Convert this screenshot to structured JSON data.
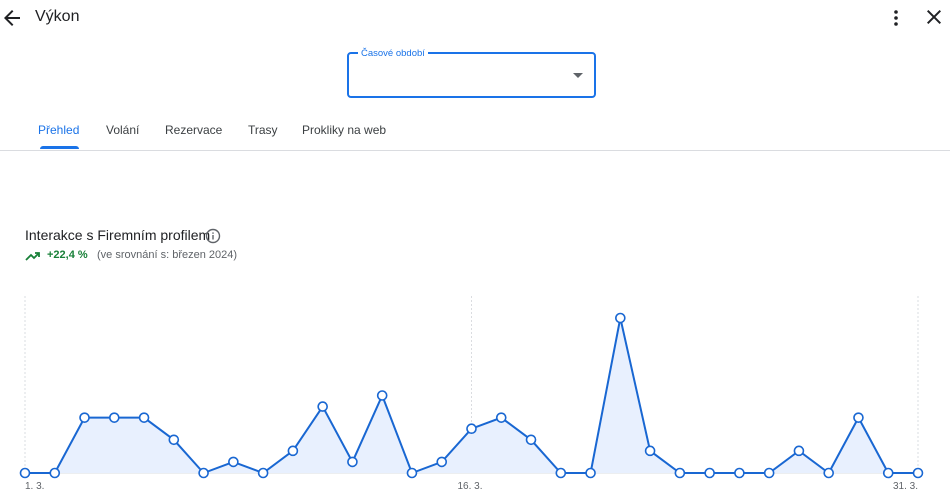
{
  "header": {
    "title": "Výkon",
    "back_icon": "arrow-back-icon",
    "more_icon": "more-vert-icon",
    "close_icon": "close-icon"
  },
  "period_select": {
    "label": "Časové období",
    "value": ""
  },
  "tabs": [
    {
      "label": "Přehled",
      "active": true
    },
    {
      "label": "Volání",
      "active": false
    },
    {
      "label": "Rezervace",
      "active": false
    },
    {
      "label": "Trasy",
      "active": false
    },
    {
      "label": "Prokliky na web",
      "active": false
    }
  ],
  "metric": {
    "title": "Interakce s Firemním profilem",
    "change": "+22,4 %",
    "comparison": "(ve srovnání s: březen 2024)"
  },
  "colors": {
    "accent": "#1a73e8",
    "positive": "#188038",
    "line": "#1967d2",
    "area": "#e8f0fe"
  },
  "chart_data": {
    "type": "area",
    "x": [
      "1. 3.",
      "2. 3.",
      "3. 3.",
      "4. 3.",
      "5. 3.",
      "6. 3.",
      "7. 3.",
      "8. 3.",
      "9. 3.",
      "10. 3.",
      "11. 3.",
      "12. 3.",
      "13. 3.",
      "14. 3.",
      "15. 3.",
      "16. 3.",
      "17. 3.",
      "18. 3.",
      "19. 3.",
      "20. 3.",
      "21. 3.",
      "22. 3.",
      "23. 3.",
      "24. 3.",
      "25. 3.",
      "26. 3.",
      "27. 3.",
      "28. 3.",
      "29. 3.",
      "30. 3.",
      "31. 3."
    ],
    "values": [
      0,
      0,
      5,
      5,
      5,
      3,
      0,
      1,
      0,
      2,
      6,
      1,
      7,
      0,
      1,
      4,
      5,
      3,
      0,
      0,
      14,
      2,
      0,
      0,
      0,
      0,
      2,
      0,
      5,
      0,
      0
    ],
    "tick_labels": [
      "1. 3.",
      "16. 3.",
      "31. 3."
    ],
    "grid": "vertical"
  }
}
